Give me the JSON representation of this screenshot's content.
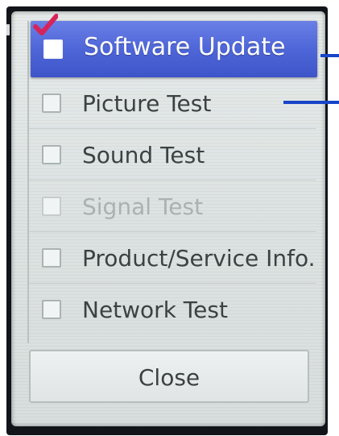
{
  "menu": {
    "items": [
      {
        "label": "Software Update",
        "checked": true,
        "selected": true,
        "enabled": true
      },
      {
        "label": "Picture Test",
        "checked": false,
        "selected": false,
        "enabled": true
      },
      {
        "label": "Sound Test",
        "checked": false,
        "selected": false,
        "enabled": true
      },
      {
        "label": "Signal Test",
        "checked": false,
        "selected": false,
        "enabled": false
      },
      {
        "label": "Product/Service Info.",
        "checked": false,
        "selected": false,
        "enabled": true
      },
      {
        "label": "Network Test",
        "checked": false,
        "selected": false,
        "enabled": true
      }
    ]
  },
  "close_button": {
    "label": "Close"
  },
  "colors": {
    "selection": "#4e66d8",
    "checkmark": "#d6245a",
    "pointer": "#1744c8",
    "panel": "#dde3e2"
  },
  "icons": {
    "checked": "checkmark-icon",
    "unchecked": "checkbox-icon"
  }
}
